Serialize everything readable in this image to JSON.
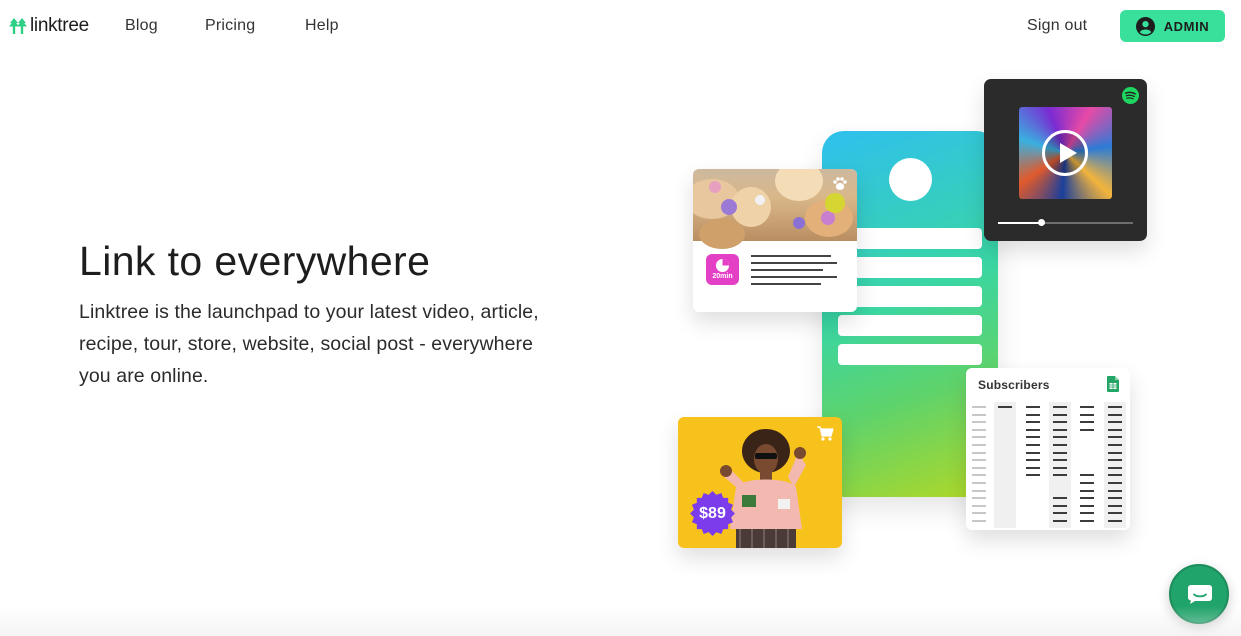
{
  "nav": {
    "logo_text": "linktree",
    "links": [
      "Blog",
      "Pricing",
      "Help"
    ],
    "signout_label": "Sign out",
    "admin_label": "ADMIN"
  },
  "hero": {
    "title": "Link to everywhere",
    "description": "Linktree is the launchpad to your latest video, article, recipe, tour, store, website, social post - everywhere you are online."
  },
  "illustration": {
    "recipe_badge": "20min",
    "price_badge": "$89",
    "sheet_title": "Subscribers",
    "video_progress": 0.32
  },
  "icons": {
    "logo": "linktree-logo-icon",
    "admin": "user-avatar-icon",
    "spotify": "spotify-icon",
    "cart": "shopping-cart-icon",
    "sheets": "google-sheets-icon",
    "chat": "chat-icon",
    "clock": "clock-icon",
    "play": "play-icon"
  },
  "colors": {
    "brand_green": "#39e09b",
    "chat_green": "#21a46b",
    "shop_yellow": "#f8c21c",
    "badge_purple": "#7c3cec",
    "badge_pink": "#e340c5"
  }
}
